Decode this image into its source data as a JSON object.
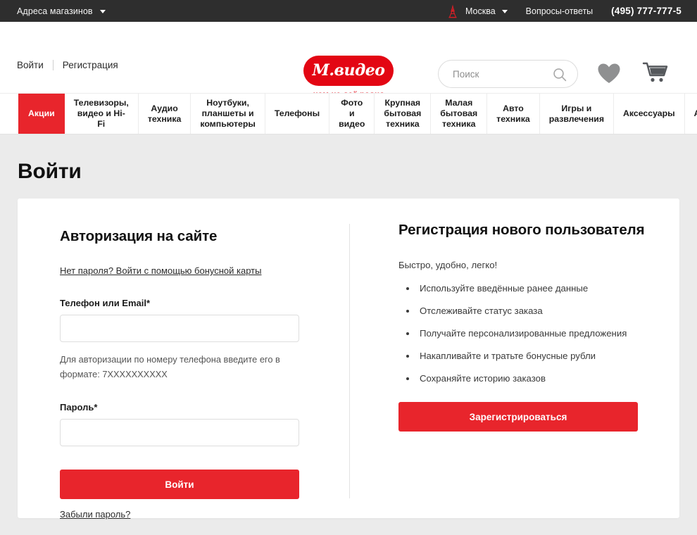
{
  "topbar": {
    "stores_label": "Адреса магазинов",
    "chevron_icon": "chevron-down-icon",
    "city_icon": "moscow-tower-icon",
    "city_label": "Москва",
    "qa_label": "Вопросы-ответы",
    "phone": "(495) 777-777-5"
  },
  "header": {
    "login_label": "Войти",
    "register_label": "Регистрация",
    "logo_text": "М.видео",
    "logo_tagline": "нам не всё равно",
    "search": {
      "value": "",
      "placeholder": "Поиск",
      "icon": "search-icon"
    },
    "favorites_icon": "heart-icon",
    "cart_icon": "cart-icon"
  },
  "nav": {
    "items": [
      {
        "label": "Акции",
        "active": true
      },
      {
        "label": "Телевизоры,\nвидео и Hi-Fi"
      },
      {
        "label": "Аудио\nтехника"
      },
      {
        "label": "Ноутбуки,\nпланшеты и\nкомпьютеры"
      },
      {
        "label": "Телефоны"
      },
      {
        "label": "Фото и\nвидео"
      },
      {
        "label": "Крупная\nбытовая\nтехника"
      },
      {
        "label": "Малая\nбытовая\nтехника"
      },
      {
        "label": "Авто\nтехника"
      },
      {
        "label": "Игры и\nразвлечения"
      },
      {
        "label": "Аксессуары"
      },
      {
        "label": "Apple"
      }
    ]
  },
  "page": {
    "title": "Войти"
  },
  "login": {
    "heading": "Авторизация на сайте",
    "bonus_card_link": "Нет пароля? Войти с помощью бонусной карты",
    "email_label": "Телефон или Email*",
    "email_value": "",
    "email_placeholder": "",
    "email_hint": "Для авторизации по номеру телефона введите его в формате: 7XXXXXXXXXX",
    "password_label": "Пароль*",
    "password_value": "",
    "password_placeholder": "",
    "submit_label": "Войти",
    "forgot_label": "Забыли пароль?"
  },
  "registration": {
    "heading": "Регистрация нового пользователя",
    "lead": "Быстро, удобно, легко!",
    "benefits": [
      "Используйте введённые ранее данные",
      "Отслеживайте статус заказа",
      "Получайте персонализированные предложения",
      "Накапливайте и тратьте бонусные рубли",
      "Сохраняйте историю заказов"
    ],
    "submit_label": "Зарегистрироваться"
  },
  "colors": {
    "brand_red": "#e8252c",
    "logo_red": "#e30613",
    "topbar_bg": "#2e2e2e",
    "page_bg": "#ebebeb"
  }
}
